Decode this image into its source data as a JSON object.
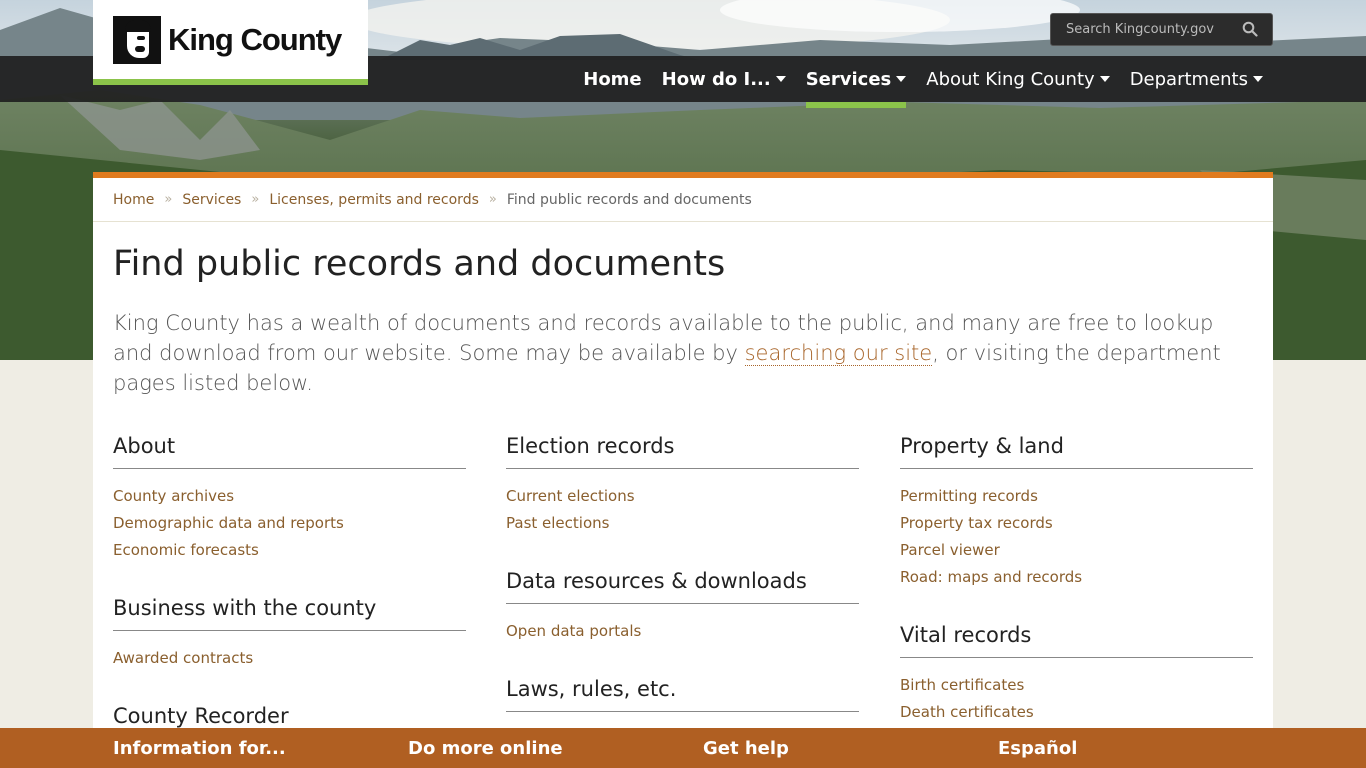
{
  "header": {
    "logo_text": "King County",
    "search_placeholder": "Search Kingcounty.gov"
  },
  "nav": {
    "items": [
      {
        "label": "Home",
        "bold": true,
        "dropdown": false,
        "active": false
      },
      {
        "label": "How do I...",
        "bold": true,
        "dropdown": true,
        "active": false
      },
      {
        "label": "Services",
        "bold": true,
        "dropdown": true,
        "active": true
      },
      {
        "label": "About King County",
        "bold": false,
        "dropdown": true,
        "active": false
      },
      {
        "label": "Departments",
        "bold": false,
        "dropdown": true,
        "active": false
      }
    ]
  },
  "breadcrumb": {
    "items": [
      "Home",
      "Services",
      "Licenses, permits and records"
    ],
    "current": "Find public records and documents"
  },
  "main": {
    "title": "Find public records and documents",
    "intro_before": "King County has a wealth of documents and records available to the public, and many are free to lookup and download from our website. Some may be available by ",
    "intro_link": "searching our site",
    "intro_after": ", or visiting the department pages listed below."
  },
  "columns": {
    "col1": [
      {
        "heading": "About",
        "links": [
          "County archives",
          "Demographic data and reports",
          "Economic forecasts"
        ]
      },
      {
        "heading": "Business with the county",
        "links": [
          "Awarded contracts"
        ]
      },
      {
        "heading": "County Recorder",
        "links": []
      }
    ],
    "col2": [
      {
        "heading": "Election records",
        "links": [
          "Current elections",
          "Past elections"
        ]
      },
      {
        "heading": "Data resources & downloads",
        "links": [
          "Open data portals"
        ]
      },
      {
        "heading": "Laws, rules, etc.",
        "links": []
      }
    ],
    "col3": [
      {
        "heading": "Property & land",
        "links": [
          "Permitting records",
          "Property tax records",
          "Parcel viewer",
          "Road: maps and records"
        ]
      },
      {
        "heading": "Vital records",
        "links": [
          "Birth certificates",
          "Death certificates"
        ]
      }
    ]
  },
  "footer": {
    "items": [
      "Information for...",
      "Do more online",
      "Get help",
      "Español"
    ]
  },
  "colors": {
    "accent_green": "#8bc34a",
    "accent_orange": "#e07b1f",
    "footer_brown": "#b05f22",
    "link_brown": "#8a5f2e"
  }
}
